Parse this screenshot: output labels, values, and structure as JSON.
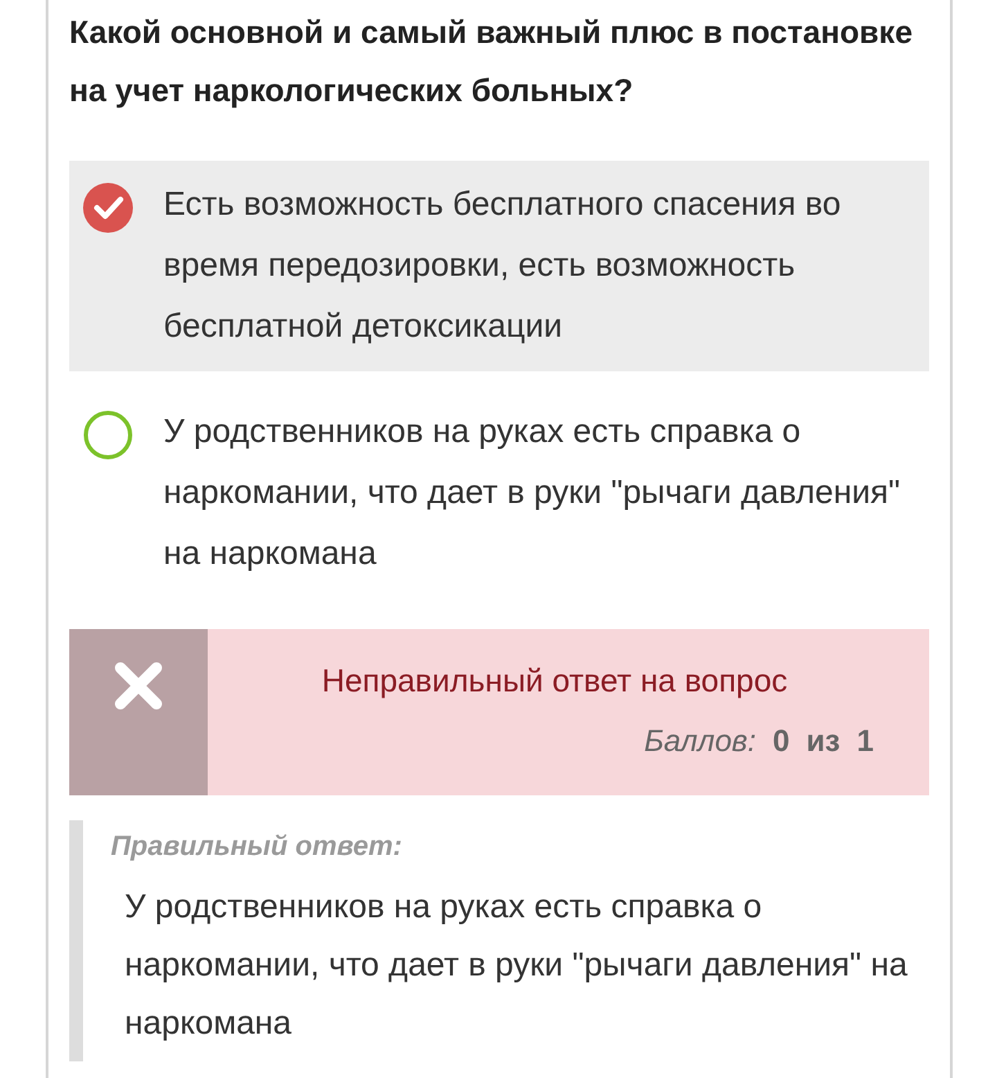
{
  "question": "Какой основной и самый важный плюс в постановке на учет наркологических больных?",
  "options": [
    {
      "text": "Есть возможность бесплатного спасения во время передозировки, есть возможность бесплатной детоксикации",
      "selected": true,
      "correct": false
    },
    {
      "text": "У родственников на руках есть справка о наркомании, что дает в руки \"рычаги давления\" на наркомана",
      "selected": false,
      "correct": true
    }
  ],
  "result": {
    "correct": false,
    "message": "Неправильный ответ на вопрос",
    "score_label": "Баллов:",
    "score": "0",
    "score_of": "из",
    "score_max": "1"
  },
  "correct_answer": {
    "label": "Правильный ответ:",
    "text": "У родственников на руках есть справка о наркомании, что дает в руки \"рычаги давления\" на наркомана"
  }
}
